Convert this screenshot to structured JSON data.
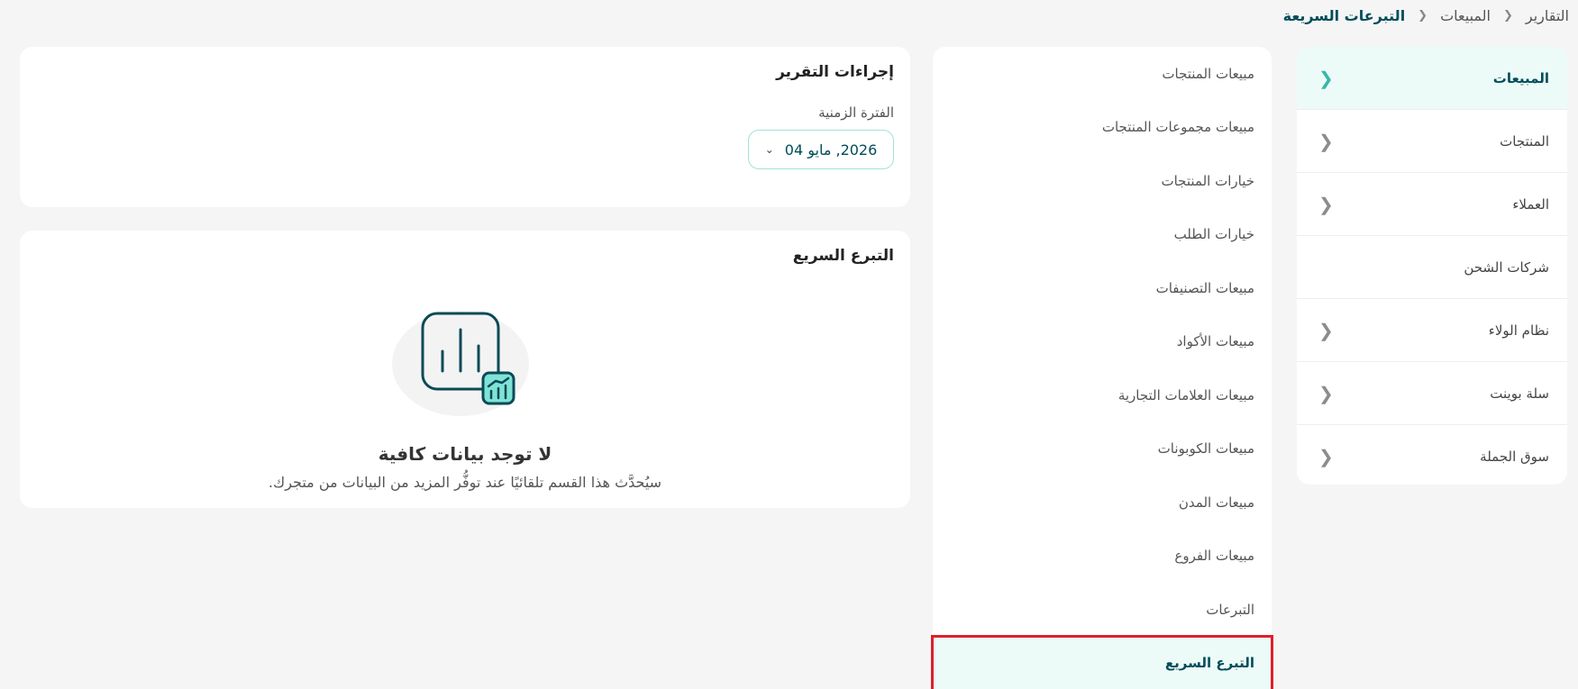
{
  "breadcrumb": {
    "items": [
      "التقارير",
      "المبيعات",
      "التبرعات السريعة"
    ]
  },
  "categories": [
    {
      "label": "المبيعات",
      "has_chevron": true,
      "active": true
    },
    {
      "label": "المنتجات",
      "has_chevron": true
    },
    {
      "label": "العملاء",
      "has_chevron": true
    },
    {
      "label": "شركات الشحن",
      "has_chevron": false
    },
    {
      "label": "نظام الولاء",
      "has_chevron": true
    },
    {
      "label": "سلة بوينت",
      "has_chevron": true
    },
    {
      "label": "سوق الجملة",
      "has_chevron": true
    }
  ],
  "submenu": [
    {
      "label": "مبيعات المنتجات"
    },
    {
      "label": "مبيعات مجموعات المنتجات"
    },
    {
      "label": "خيارات المنتجات"
    },
    {
      "label": "خيارات الطلب"
    },
    {
      "label": "مبيعات التصنيفات"
    },
    {
      "label": "مبيعات الأكواد"
    },
    {
      "label": "مبيعات العلامات التجارية"
    },
    {
      "label": "مبيعات الكوبونات"
    },
    {
      "label": "مبيعات المدن"
    },
    {
      "label": "مبيعات الفروع"
    },
    {
      "label": "التبرعات"
    },
    {
      "label": "التبرع السريع",
      "active": true
    }
  ],
  "actions": {
    "title": "إجراءات التقرير",
    "period_label": "الفترة الزمنية",
    "period_value": "2026, مايو 04"
  },
  "quick_donation": {
    "title": "التبرع السريع",
    "empty_title": "لا توجد بيانات كافية",
    "empty_subtitle": "سيُحدَّث هذا القسم تلقائيًا عند توفُّر المزيد من البيانات من متجرك."
  },
  "colors": {
    "accent": "#004d5a",
    "accent_light": "#edfbf8",
    "highlight_border": "#e01e2a",
    "icon_teal": "#7fe3d5"
  }
}
